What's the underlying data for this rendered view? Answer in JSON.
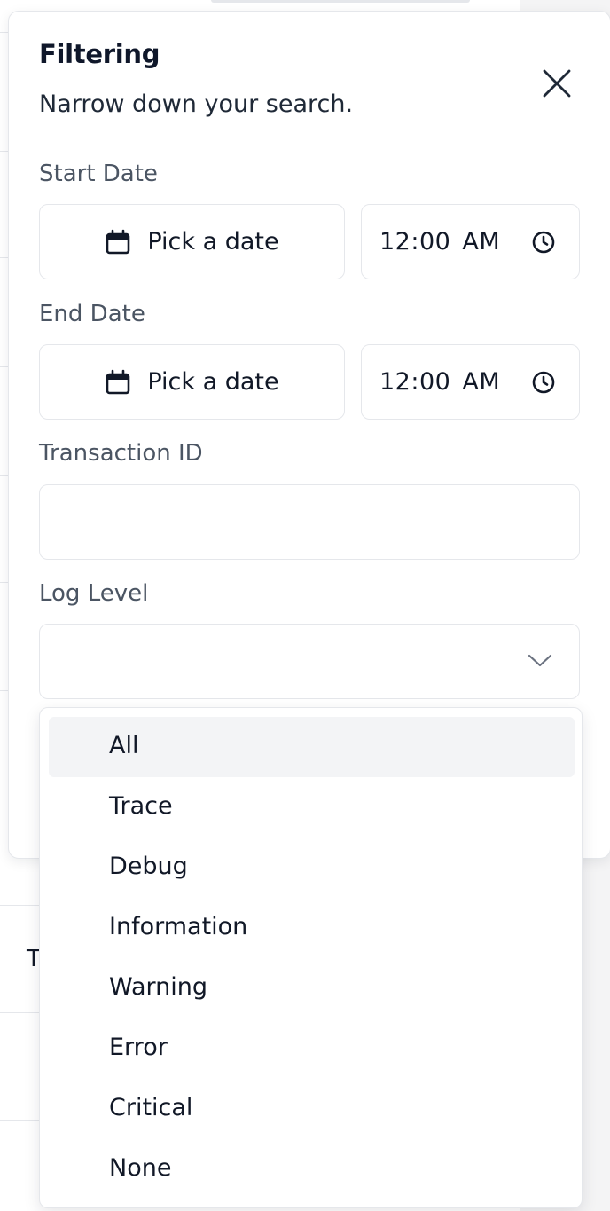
{
  "background": {
    "partial_text": "T"
  },
  "panel": {
    "title": "Filtering",
    "description": "Narrow down your search."
  },
  "start_date": {
    "label": "Start Date",
    "date_button": "Pick a date",
    "time_value": "12:00 AM"
  },
  "end_date": {
    "label": "End Date",
    "date_button": "Pick a date",
    "time_value": "12:00 AM"
  },
  "transaction_id": {
    "label": "Transaction ID",
    "value": ""
  },
  "log_level": {
    "label": "Log Level",
    "selected": "",
    "options": [
      "All",
      "Trace",
      "Debug",
      "Information",
      "Warning",
      "Error",
      "Critical",
      "None"
    ],
    "highlighted": "All"
  },
  "icons": {
    "close": "close-icon",
    "calendar": "calendar-icon",
    "clock": "clock-icon",
    "chevron": "chevron-down-icon"
  },
  "colors": {
    "border": "#e5e7eb",
    "highlight": "#f3f4f6",
    "text": "#0f172a",
    "muted": "#4b5563"
  }
}
